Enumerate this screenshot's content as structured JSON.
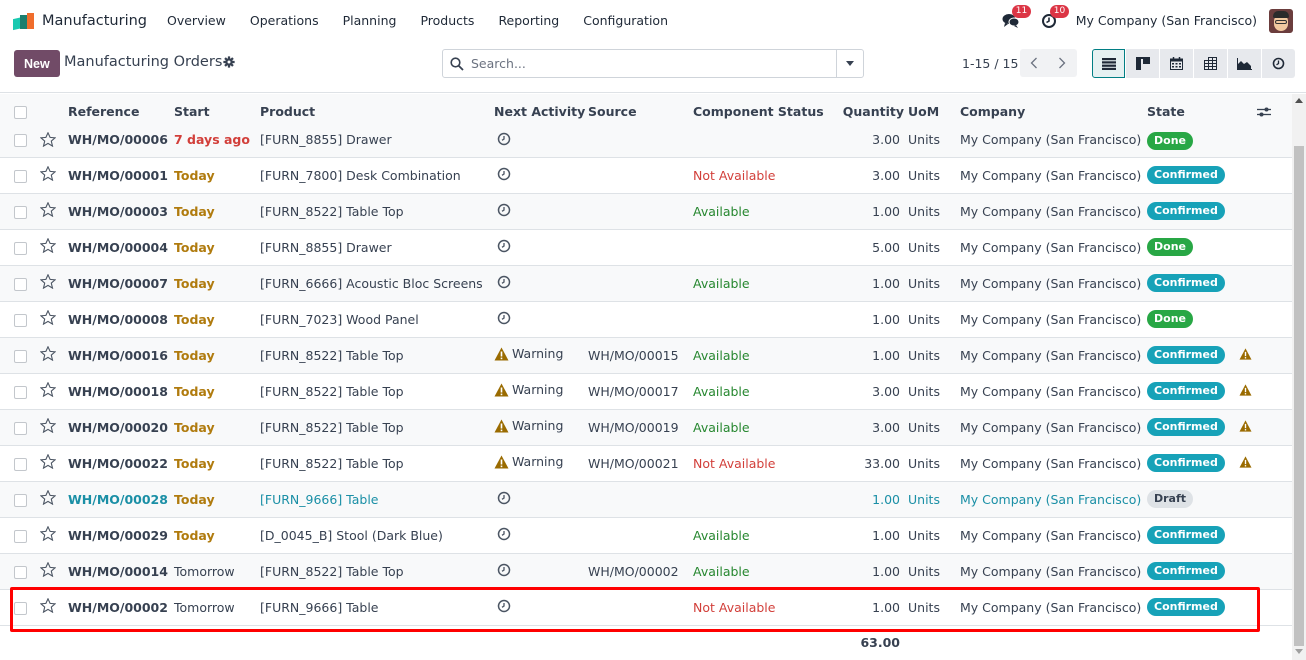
{
  "navbar": {
    "app_name": "Manufacturing",
    "menu": [
      "Overview",
      "Operations",
      "Planning",
      "Products",
      "Reporting",
      "Configuration"
    ],
    "messages_count": "11",
    "activities_count": "10",
    "company": "My Company (San Francisco)"
  },
  "control": {
    "new_label": "New",
    "title": "Manufacturing Orders",
    "search_placeholder": "Search...",
    "search_value": "",
    "pager": "1-15 / 15",
    "views": [
      "list",
      "kanban",
      "calendar",
      "pivot",
      "graph",
      "activity"
    ],
    "active_view": "list"
  },
  "table": {
    "headers": {
      "reference": "Reference",
      "start": "Start",
      "product": "Product",
      "next_activity": "Next Activity",
      "source": "Source",
      "component_status": "Component Status",
      "quantity": "Quantity",
      "uom": "UoM",
      "company": "Company",
      "state": "State"
    },
    "rows": [
      {
        "reference": "WH/MO/00006",
        "start": "7 days ago",
        "start_style": "overdue",
        "product": "[FURN_8855] Drawer",
        "activity": "clock",
        "activity_label": "",
        "source": "",
        "component_status": "",
        "status_style": "",
        "quantity": "3.00",
        "uom": "Units",
        "company": "My Company (San Francisco)",
        "state": "Done",
        "warning": false
      },
      {
        "reference": "WH/MO/00001",
        "start": "Today",
        "start_style": "today",
        "product": "[FURN_7800] Desk Combination",
        "activity": "clock",
        "activity_label": "",
        "source": "",
        "component_status": "Not Available",
        "status_style": "not-available",
        "quantity": "3.00",
        "uom": "Units",
        "company": "My Company (San Francisco)",
        "state": "Confirmed",
        "warning": false
      },
      {
        "reference": "WH/MO/00003",
        "start": "Today",
        "start_style": "today",
        "product": "[FURN_8522] Table Top",
        "activity": "clock",
        "activity_label": "",
        "source": "",
        "component_status": "Available",
        "status_style": "available",
        "quantity": "1.00",
        "uom": "Units",
        "company": "My Company (San Francisco)",
        "state": "Confirmed",
        "warning": false
      },
      {
        "reference": "WH/MO/00004",
        "start": "Today",
        "start_style": "today",
        "product": "[FURN_8855] Drawer",
        "activity": "clock",
        "activity_label": "",
        "source": "",
        "component_status": "",
        "status_style": "",
        "quantity": "5.00",
        "uom": "Units",
        "company": "My Company (San Francisco)",
        "state": "Done",
        "warning": false
      },
      {
        "reference": "WH/MO/00007",
        "start": "Today",
        "start_style": "today",
        "product": "[FURN_6666] Acoustic Bloc Screens",
        "activity": "clock",
        "activity_label": "",
        "source": "",
        "component_status": "Available",
        "status_style": "available",
        "quantity": "1.00",
        "uom": "Units",
        "company": "My Company (San Francisco)",
        "state": "Confirmed",
        "warning": false
      },
      {
        "reference": "WH/MO/00008",
        "start": "Today",
        "start_style": "today",
        "product": "[FURN_7023] Wood Panel",
        "activity": "clock",
        "activity_label": "",
        "source": "",
        "component_status": "",
        "status_style": "",
        "quantity": "1.00",
        "uom": "Units",
        "company": "My Company (San Francisco)",
        "state": "Done",
        "warning": false
      },
      {
        "reference": "WH/MO/00016",
        "start": "Today",
        "start_style": "today",
        "product": "[FURN_8522] Table Top",
        "activity": "warning",
        "activity_label": "Warning",
        "source": "WH/MO/00015",
        "component_status": "Available",
        "status_style": "available",
        "quantity": "1.00",
        "uom": "Units",
        "company": "My Company (San Francisco)",
        "state": "Confirmed",
        "warning": true
      },
      {
        "reference": "WH/MO/00018",
        "start": "Today",
        "start_style": "today",
        "product": "[FURN_8522] Table Top",
        "activity": "warning",
        "activity_label": "Warning",
        "source": "WH/MO/00017",
        "component_status": "Available",
        "status_style": "available",
        "quantity": "3.00",
        "uom": "Units",
        "company": "My Company (San Francisco)",
        "state": "Confirmed",
        "warning": true
      },
      {
        "reference": "WH/MO/00020",
        "start": "Today",
        "start_style": "today",
        "product": "[FURN_8522] Table Top",
        "activity": "warning",
        "activity_label": "Warning",
        "source": "WH/MO/00019",
        "component_status": "Available",
        "status_style": "available",
        "quantity": "3.00",
        "uom": "Units",
        "company": "My Company (San Francisco)",
        "state": "Confirmed",
        "warning": true
      },
      {
        "reference": "WH/MO/00022",
        "start": "Today",
        "start_style": "today",
        "product": "[FURN_8522] Table Top",
        "activity": "warning",
        "activity_label": "Warning",
        "source": "WH/MO/00021",
        "component_status": "Not Available",
        "status_style": "not-available",
        "quantity": "33.00",
        "uom": "Units",
        "company": "My Company (San Francisco)",
        "state": "Confirmed",
        "warning": true
      },
      {
        "reference": "WH/MO/00028",
        "start": "Today",
        "start_style": "today",
        "product": "[FURN_9666] Table",
        "activity": "clock",
        "activity_label": "",
        "source": "",
        "component_status": "",
        "status_style": "",
        "quantity": "1.00",
        "uom": "Units",
        "company": "My Company (San Francisco)",
        "state": "Draft",
        "warning": false,
        "draft": true
      },
      {
        "reference": "WH/MO/00029",
        "start": "Today",
        "start_style": "today",
        "product": "[D_0045_B] Stool (Dark Blue)",
        "activity": "clock",
        "activity_label": "",
        "source": "",
        "component_status": "Available",
        "status_style": "available",
        "quantity": "1.00",
        "uom": "Units",
        "company": "My Company (San Francisco)",
        "state": "Confirmed",
        "warning": false
      },
      {
        "reference": "WH/MO/00014",
        "start": "Tomorrow",
        "start_style": "future",
        "product": "[FURN_8522] Table Top",
        "activity": "clock",
        "activity_label": "",
        "source": "WH/MO/00002",
        "component_status": "Available",
        "status_style": "available",
        "quantity": "1.00",
        "uom": "Units",
        "company": "My Company (San Francisco)",
        "state": "Confirmed",
        "warning": false
      },
      {
        "reference": "WH/MO/00002",
        "start": "Tomorrow",
        "start_style": "future",
        "product": "[FURN_9666] Table",
        "activity": "clock",
        "activity_label": "",
        "source": "",
        "component_status": "Not Available",
        "status_style": "not-available",
        "quantity": "1.00",
        "uom": "Units",
        "company": "My Company (San Francisco)",
        "state": "Confirmed",
        "warning": false,
        "highlighted": true
      }
    ],
    "total_quantity": "63.00"
  },
  "colors": {
    "brand": "#714b67",
    "overdue": "#d23f3a",
    "today": "#b07b0e",
    "available": "#26872f",
    "not_available": "#d23f3a",
    "done": "#28a745",
    "confirmed": "#17a2b8",
    "draft_link": "#1a8fa6",
    "warning_icon": "#9a6b00",
    "highlight": "#ff0000"
  }
}
